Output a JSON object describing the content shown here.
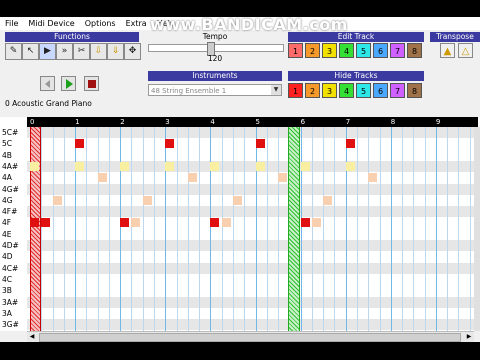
{
  "watermark": "www.BANDICAM.com",
  "menu": [
    "File",
    "Midi Device",
    "Options",
    "Extra",
    "Help"
  ],
  "panels": {
    "functions": "Functions",
    "tempo": "Tempo",
    "edit_track": "Edit Track",
    "transpose": "Transpose",
    "instruments": "Instruments",
    "hide_tracks": "Hide Tracks"
  },
  "tools": [
    "pencil-icon",
    "select-icon",
    "play-from-icon",
    "fast-forward-icon",
    "scissors-icon",
    "paste-icon",
    "paste-down-icon",
    "move-icon"
  ],
  "tempo": {
    "value": "120",
    "fraction": 0.45
  },
  "tracks": [
    {
      "label": "1",
      "color": "#ff6a6a"
    },
    {
      "label": "2",
      "color": "#f59a2a"
    },
    {
      "label": "3",
      "color": "#f2e000"
    },
    {
      "label": "4",
      "color": "#34e034"
    },
    {
      "label": "5",
      "color": "#2ee8e8"
    },
    {
      "label": "6",
      "color": "#4aa8ff"
    },
    {
      "label": "7",
      "color": "#d060ff"
    },
    {
      "label": "8",
      "color": "#a0724a"
    }
  ],
  "hide_tracks": [
    {
      "label": "1",
      "color": "#ff2020"
    },
    {
      "label": "2",
      "color": "#f59a2a"
    },
    {
      "label": "3",
      "color": "#f2e000"
    },
    {
      "label": "4",
      "color": "#34e034"
    },
    {
      "label": "5",
      "color": "#2ee8e8"
    },
    {
      "label": "6",
      "color": "#4aa8ff"
    },
    {
      "label": "7",
      "color": "#d060ff"
    },
    {
      "label": "8",
      "color": "#a0724a"
    }
  ],
  "instrument_label": "0 Acoustic Grand Piano",
  "instrument_select": "48 String Ensemble 1",
  "ruler": [
    "0",
    "1",
    "2",
    "3",
    "4",
    "5",
    "6",
    "7",
    "8",
    "9"
  ],
  "notes": [
    "5C#",
    "5C",
    "4B",
    "4A#",
    "4A",
    "4G#",
    "4G",
    "4F#",
    "4F",
    "4E",
    "4D#",
    "4D",
    "4C#",
    "4C",
    "3B",
    "3A#",
    "3A",
    "3G#"
  ],
  "note_events": [
    {
      "pitch": "5C",
      "beat": 1.0,
      "length": 0.2,
      "color": "#e01010"
    },
    {
      "pitch": "5C",
      "beat": 3.0,
      "length": 0.2,
      "color": "#e01010"
    },
    {
      "pitch": "5C",
      "beat": 5.0,
      "length": 0.2,
      "color": "#e01010"
    },
    {
      "pitch": "5C",
      "beat": 7.0,
      "length": 0.2,
      "color": "#e01010"
    },
    {
      "pitch": "4A#",
      "beat": 0.0,
      "length": 0.2,
      "color": "#f8f0a0"
    },
    {
      "pitch": "4A#",
      "beat": 1.0,
      "length": 0.2,
      "color": "#f8f0a0"
    },
    {
      "pitch": "4A#",
      "beat": 2.0,
      "length": 0.2,
      "color": "#f8f0a0"
    },
    {
      "pitch": "4A#",
      "beat": 3.0,
      "length": 0.2,
      "color": "#f8f0a0"
    },
    {
      "pitch": "4A#",
      "beat": 4.0,
      "length": 0.2,
      "color": "#f8f0a0"
    },
    {
      "pitch": "4A#",
      "beat": 5.0,
      "length": 0.2,
      "color": "#f8f0a0"
    },
    {
      "pitch": "4A#",
      "beat": 6.0,
      "length": 0.2,
      "color": "#f8f0a0"
    },
    {
      "pitch": "4A#",
      "beat": 7.0,
      "length": 0.2,
      "color": "#f8f0a0"
    },
    {
      "pitch": "4A",
      "beat": 1.5,
      "length": 0.2,
      "color": "#f8d0b0"
    },
    {
      "pitch": "4A",
      "beat": 3.5,
      "length": 0.2,
      "color": "#f8d0b0"
    },
    {
      "pitch": "4A",
      "beat": 5.5,
      "length": 0.2,
      "color": "#f8d0b0"
    },
    {
      "pitch": "4A",
      "beat": 7.5,
      "length": 0.2,
      "color": "#f8d0b0"
    },
    {
      "pitch": "4G",
      "beat": 0.5,
      "length": 0.2,
      "color": "#f8d0b0"
    },
    {
      "pitch": "4G",
      "beat": 2.5,
      "length": 0.2,
      "color": "#f8d0b0"
    },
    {
      "pitch": "4G",
      "beat": 4.5,
      "length": 0.2,
      "color": "#f8d0b0"
    },
    {
      "pitch": "4G",
      "beat": 6.5,
      "length": 0.2,
      "color": "#f8d0b0"
    },
    {
      "pitch": "4F",
      "beat": 0.0,
      "length": 0.2,
      "color": "#e01010"
    },
    {
      "pitch": "4F",
      "beat": 0.25,
      "length": 0.2,
      "color": "#e01010"
    },
    {
      "pitch": "4F",
      "beat": 2.0,
      "length": 0.2,
      "color": "#e01010"
    },
    {
      "pitch": "4F",
      "beat": 2.25,
      "length": 0.2,
      "color": "#f8d0b0"
    },
    {
      "pitch": "4F",
      "beat": 4.0,
      "length": 0.2,
      "color": "#e01010"
    },
    {
      "pitch": "4F",
      "beat": 4.25,
      "length": 0.2,
      "color": "#f8d0b0"
    },
    {
      "pitch": "4F",
      "beat": 6.0,
      "length": 0.2,
      "color": "#e01010"
    },
    {
      "pitch": "4F",
      "beat": 6.25,
      "length": 0.2,
      "color": "#f8d0b0"
    }
  ]
}
